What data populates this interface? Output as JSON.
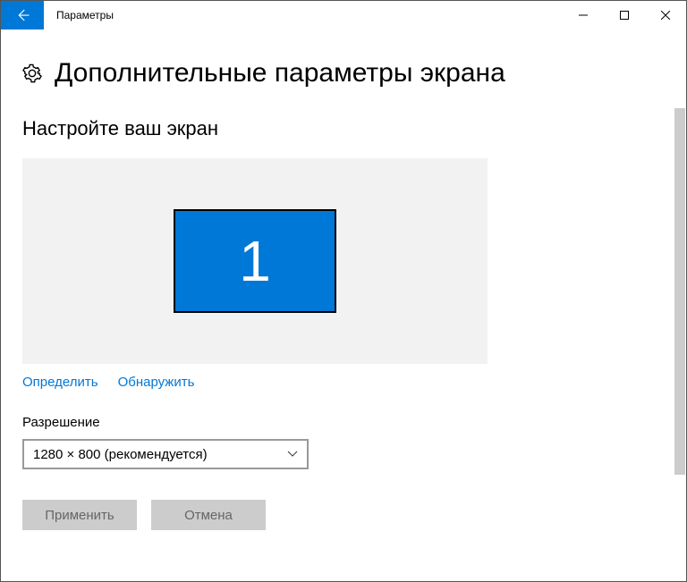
{
  "titlebar": {
    "title": "Параметры"
  },
  "page": {
    "title": "Дополнительные параметры экрана",
    "section_title": "Настройте ваш экран"
  },
  "monitor": {
    "number": "1"
  },
  "links": {
    "identify": "Определить",
    "detect": "Обнаружить"
  },
  "resolution": {
    "label": "Разрешение",
    "value": "1280 × 800 (рекомендуется)"
  },
  "buttons": {
    "apply": "Применить",
    "cancel": "Отмена"
  }
}
